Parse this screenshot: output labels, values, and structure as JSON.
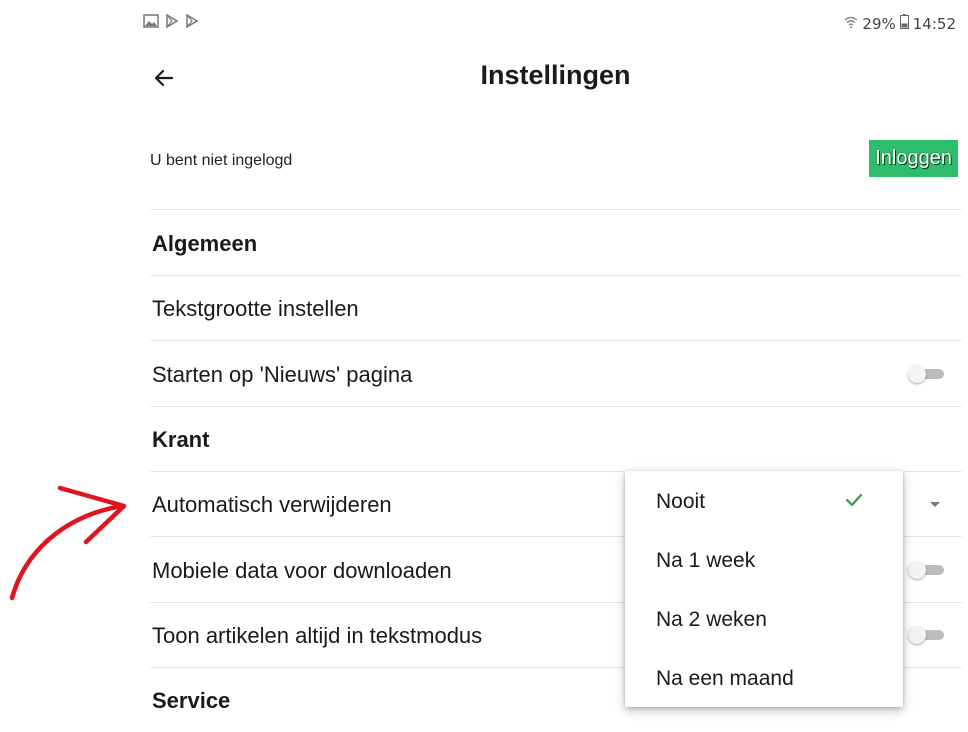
{
  "status_bar": {
    "left_icons": [
      "image-icon",
      "play-store-icon",
      "play-store-icon"
    ],
    "battery": "29%",
    "time": "14:52",
    "right_icons": [
      "wifi-icon",
      "battery-icon"
    ]
  },
  "app_bar": {
    "title": "Instellingen",
    "back_icon": "arrow-left-icon"
  },
  "account": {
    "status_text": "U bent niet ingelogd",
    "login_label": "Inloggen",
    "login_color": "#2ebd6b"
  },
  "settings": {
    "section_general": "Algemeen",
    "text_size": "Tekstgrootte instellen",
    "start_news": "Starten op 'Nieuws' pagina",
    "start_news_enabled": false,
    "section_newspaper": "Krant",
    "auto_delete": "Automatisch verwijderen",
    "mobile_data": "Mobiele data voor downloaden",
    "mobile_data_enabled": false,
    "text_mode": "Toon artikelen altijd in tekstmodus",
    "text_mode_enabled": false,
    "section_service": "Service"
  },
  "auto_delete_menu": {
    "options": [
      "Nooit",
      "Na 1 week",
      "Na 2 weken",
      "Na een maand"
    ],
    "selected": "Nooit",
    "check_color": "#2e9e46"
  },
  "annotation": {
    "arrow_color": "#e0141e"
  }
}
